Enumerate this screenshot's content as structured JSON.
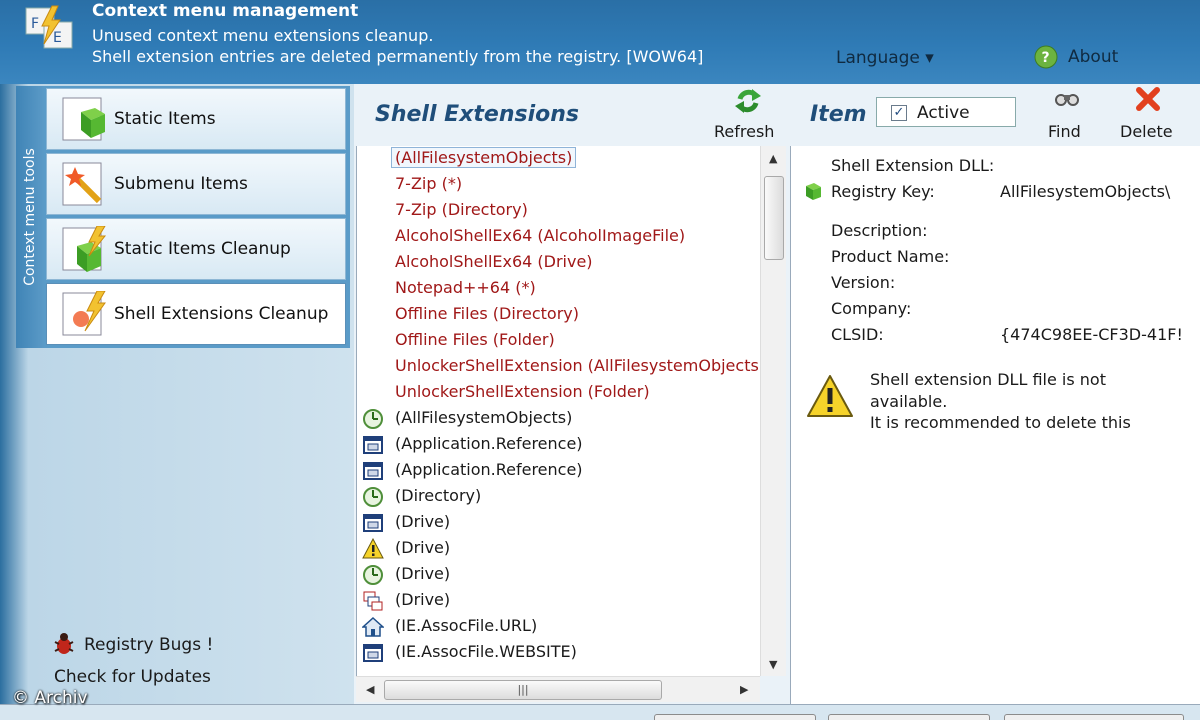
{
  "header": {
    "title": "Context menu management",
    "subtitle1": "Unused context menu extensions cleanup.",
    "subtitle2": "Shell extension entries are deleted permanently from the registry. [WOW64]",
    "language": "Language ▾",
    "about": "About"
  },
  "sidebar": {
    "tab_label": "Context menu tools",
    "items": [
      {
        "label": "Static Items",
        "icon": "cube-icon"
      },
      {
        "label": "Submenu Items",
        "icon": "wand-icon"
      },
      {
        "label": "Static Items Cleanup",
        "icon": "cube-lightning-icon"
      },
      {
        "label": "Shell Extensions Cleanup",
        "icon": "lightning-icon"
      }
    ],
    "registry_bugs": "Registry Bugs !",
    "check_updates": "Check for Updates"
  },
  "shell_extensions": {
    "title": "Shell Extensions",
    "refresh": "Refresh",
    "items": [
      {
        "text": "(AllFilesystemObjects)",
        "icon": "none",
        "style": "sel"
      },
      {
        "text": "7-Zip (*)",
        "icon": "none",
        "style": "red"
      },
      {
        "text": "7-Zip (Directory)",
        "icon": "none",
        "style": "red"
      },
      {
        "text": "AlcoholShellEx64 (AlcoholImageFile)",
        "icon": "none",
        "style": "red"
      },
      {
        "text": "AlcoholShellEx64 (Drive)",
        "icon": "none",
        "style": "red"
      },
      {
        "text": "Notepad++64 (*)",
        "icon": "none",
        "style": "red"
      },
      {
        "text": "Offline Files (Directory)",
        "icon": "none",
        "style": "red"
      },
      {
        "text": "Offline Files (Folder)",
        "icon": "none",
        "style": "red"
      },
      {
        "text": "UnlockerShellExtension (AllFilesystemObjects)",
        "icon": "none",
        "style": "red"
      },
      {
        "text": "UnlockerShellExtension (Folder)",
        "icon": "none",
        "style": "red"
      },
      {
        "text": "(AllFilesystemObjects)",
        "icon": "clock-icon",
        "style": "normal"
      },
      {
        "text": "(Application.Reference)",
        "icon": "window-icon",
        "style": "normal"
      },
      {
        "text": "(Application.Reference)",
        "icon": "window-icon",
        "style": "normal"
      },
      {
        "text": "(Directory)",
        "icon": "clock-icon",
        "style": "normal"
      },
      {
        "text": "(Drive)",
        "icon": "window-icon",
        "style": "normal"
      },
      {
        "text": "(Drive)",
        "icon": "warning-icon",
        "style": "normal"
      },
      {
        "text": "(Drive)",
        "icon": "clock-icon",
        "style": "normal"
      },
      {
        "text": "(Drive)",
        "icon": "windows-stack-icon",
        "style": "normal"
      },
      {
        "text": "(IE.AssocFile.URL)",
        "icon": "house-icon",
        "style": "normal"
      },
      {
        "text": "(IE.AssocFile.WEBSITE)",
        "icon": "window-icon",
        "style": "normal"
      }
    ]
  },
  "item_details": {
    "title": "Item Details",
    "active_label": "Active",
    "active_checked": true,
    "find": "Find",
    "delete": "Delete",
    "properties": [
      {
        "label": "Shell Extension DLL:",
        "value": ""
      },
      {
        "label": "Registry Key:",
        "value": "AllFilesystemObjects\\"
      },
      {
        "label": "Description:",
        "value": ""
      },
      {
        "label": "Product Name:",
        "value": ""
      },
      {
        "label": "Version:",
        "value": ""
      },
      {
        "label": "Company:",
        "value": ""
      },
      {
        "label": "CLSID:",
        "value": "{474C98EE-CF3D-41F!"
      }
    ],
    "warning_lines": [
      "Shell extension DLL file is not",
      "available.",
      "It is recommended to delete this"
    ]
  },
  "watermark": "© Archiv"
}
